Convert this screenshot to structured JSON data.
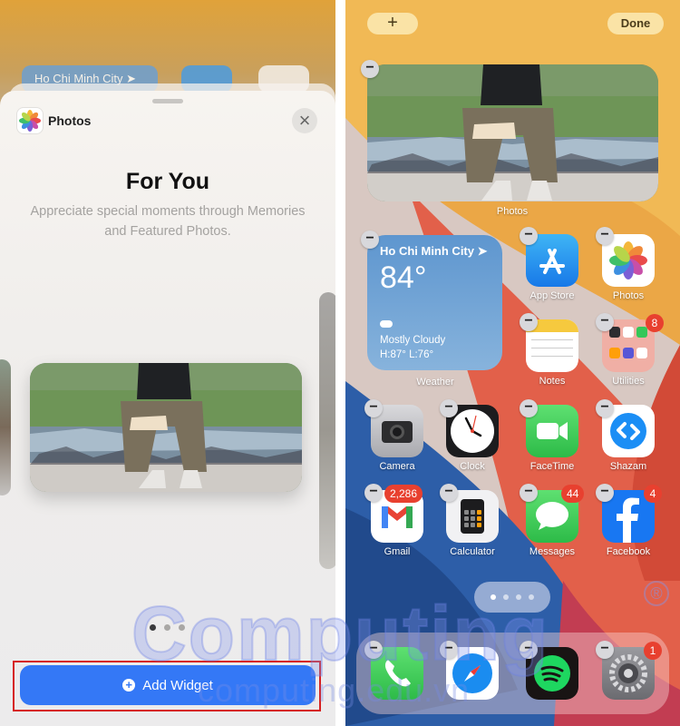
{
  "left_panel": {
    "background_chip_text": "Ho Chi Minh City ➤",
    "app_name": "Photos",
    "close_glyph": "×",
    "title": "For You",
    "description": "Appreciate special moments through Memories and Featured Photos.",
    "add_widget_label": "Add Widget",
    "page_indicator": {
      "count": 3,
      "active_index": 0
    }
  },
  "right_panel": {
    "top_plus_label": "+",
    "done_label": "Done",
    "photos_widget_label": "Photos",
    "weather": {
      "city": "Ho Chi Minh City ➤",
      "temperature": "84°",
      "condition": "Mostly Cloudy",
      "high_low": "H:87° L:76°",
      "label": "Weather"
    },
    "apps": [
      {
        "name": "App Store",
        "icon": "app-store-icon",
        "badge": ""
      },
      {
        "name": "Photos",
        "icon": "photos-icon",
        "badge": ""
      },
      {
        "name": "Notes",
        "icon": "notes-icon",
        "badge": ""
      },
      {
        "name": "Utilities",
        "icon": "utilities-folder-icon",
        "badge": "8"
      },
      {
        "name": "Camera",
        "icon": "camera-icon",
        "badge": ""
      },
      {
        "name": "Clock",
        "icon": "clock-icon",
        "badge": ""
      },
      {
        "name": "FaceTime",
        "icon": "facetime-icon",
        "badge": ""
      },
      {
        "name": "Shazam",
        "icon": "shazam-icon",
        "badge": ""
      },
      {
        "name": "Gmail",
        "icon": "gmail-icon",
        "badge": "2,286"
      },
      {
        "name": "Calculator",
        "icon": "calculator-icon",
        "badge": ""
      },
      {
        "name": "Messages",
        "icon": "messages-icon",
        "badge": "44"
      },
      {
        "name": "Facebook",
        "icon": "facebook-icon",
        "badge": "4"
      }
    ],
    "dock": [
      {
        "name": "Phone",
        "icon": "phone-icon",
        "badge": ""
      },
      {
        "name": "Safari",
        "icon": "safari-icon",
        "badge": ""
      },
      {
        "name": "Spotify",
        "icon": "spotify-icon",
        "badge": ""
      },
      {
        "name": "Settings",
        "icon": "settings-icon",
        "badge": "1"
      }
    ],
    "page_indicator": {
      "count": 4,
      "active_index": 0
    }
  },
  "watermark": {
    "text": "Computing",
    "url": "computing.edu.vn",
    "mark": "®"
  },
  "colors": {
    "add_widget_blue": "#3478f6",
    "highlight_red": "#d62020",
    "badge_red": "#e8402f"
  }
}
